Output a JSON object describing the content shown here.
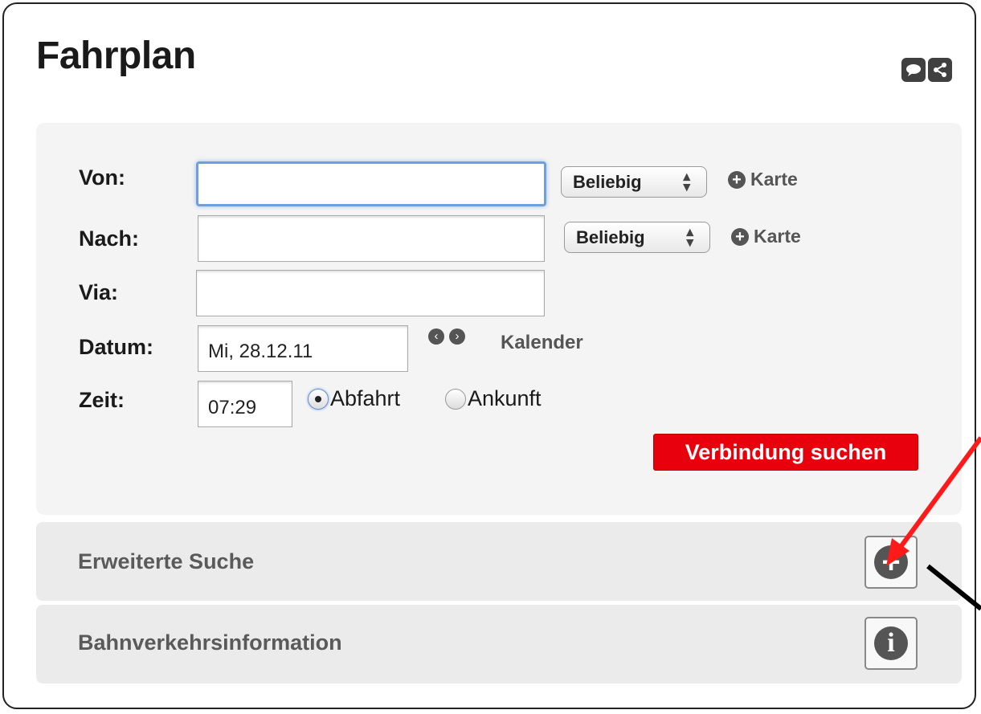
{
  "page": {
    "title": "Fahrplan"
  },
  "header_icons": [
    "comment-icon",
    "share-icon"
  ],
  "form": {
    "von": {
      "label": "Von:",
      "value": "",
      "select": "Beliebig",
      "map_link": "Karte"
    },
    "nach": {
      "label": "Nach:",
      "value": "",
      "select": "Beliebig",
      "map_link": "Karte"
    },
    "via": {
      "label": "Via:",
      "value": ""
    },
    "datum": {
      "label": "Datum:",
      "value": "Mi, 28.12.11",
      "calendar_link": "Kalender"
    },
    "zeit": {
      "label": "Zeit:",
      "value": "07:29",
      "option_departure": "Abfahrt",
      "option_arrival": "Ankunft",
      "selected": "Abfahrt"
    },
    "submit_label": "Verbindung suchen"
  },
  "sections": {
    "advanced_search": {
      "label": "Erweiterte Suche",
      "icon": "plus-circle-icon"
    },
    "rail_info": {
      "label": "Bahnverkehrsinformation",
      "icon": "info-icon"
    }
  },
  "colors": {
    "accent_red": "#e8000c",
    "focus_blue": "#6f9fdc",
    "arrow_red": "#ff1a1a",
    "arrow_black": "#000000"
  }
}
